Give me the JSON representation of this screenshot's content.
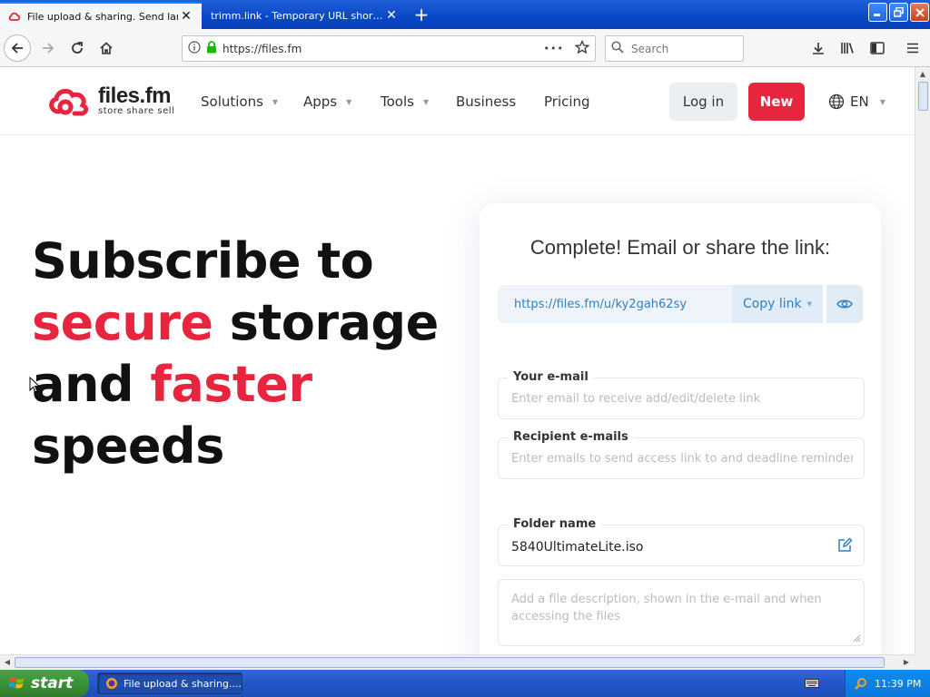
{
  "browser": {
    "tabs": [
      {
        "title": "File upload & sharing. Send large p",
        "active": true
      },
      {
        "title": "trimm.link - Temporary URL shortener",
        "active": false
      }
    ],
    "url": "https://files.fm",
    "url_menu": "•••",
    "search_placeholder": "Search"
  },
  "site": {
    "logo": {
      "name": "files.fm",
      "tagline": "store share sell"
    },
    "menu": [
      {
        "label": "Solutions",
        "has_caret": true
      },
      {
        "label": "Apps",
        "has_caret": true
      },
      {
        "label": "Tools",
        "has_caret": true
      },
      {
        "label": "Business",
        "has_caret": false
      },
      {
        "label": "Pricing",
        "has_caret": false
      }
    ],
    "login_label": "Log in",
    "new_label": "New",
    "lang_label": "EN",
    "accent_color": "#e8253f"
  },
  "hero": {
    "line1": "Subscribe to",
    "line2_red": "secure",
    "line2_rest": " storage",
    "line3_start": "and ",
    "line3_red": "faster",
    "line4": "speeds"
  },
  "share_card": {
    "title": "Complete! Email or share the link:",
    "link": "https://files.fm/u/ky2gah62sy",
    "copy_label": "Copy link",
    "email_label": "Your e-mail",
    "email_placeholder": "Enter email to receive add/edit/delete link",
    "recipients_label": "Recipient e-mails",
    "recipients_placeholder": "Enter emails to send access link to and deadline reminders",
    "folder_label": "Folder name",
    "folder_value": "5840UltimateLite.iso",
    "description_placeholder": "Add a file description, shown in the e-mail and when accessing the files"
  },
  "taskbar": {
    "start_label": "start",
    "task_label": "File upload & sharing....",
    "clock": "11:39 PM"
  }
}
